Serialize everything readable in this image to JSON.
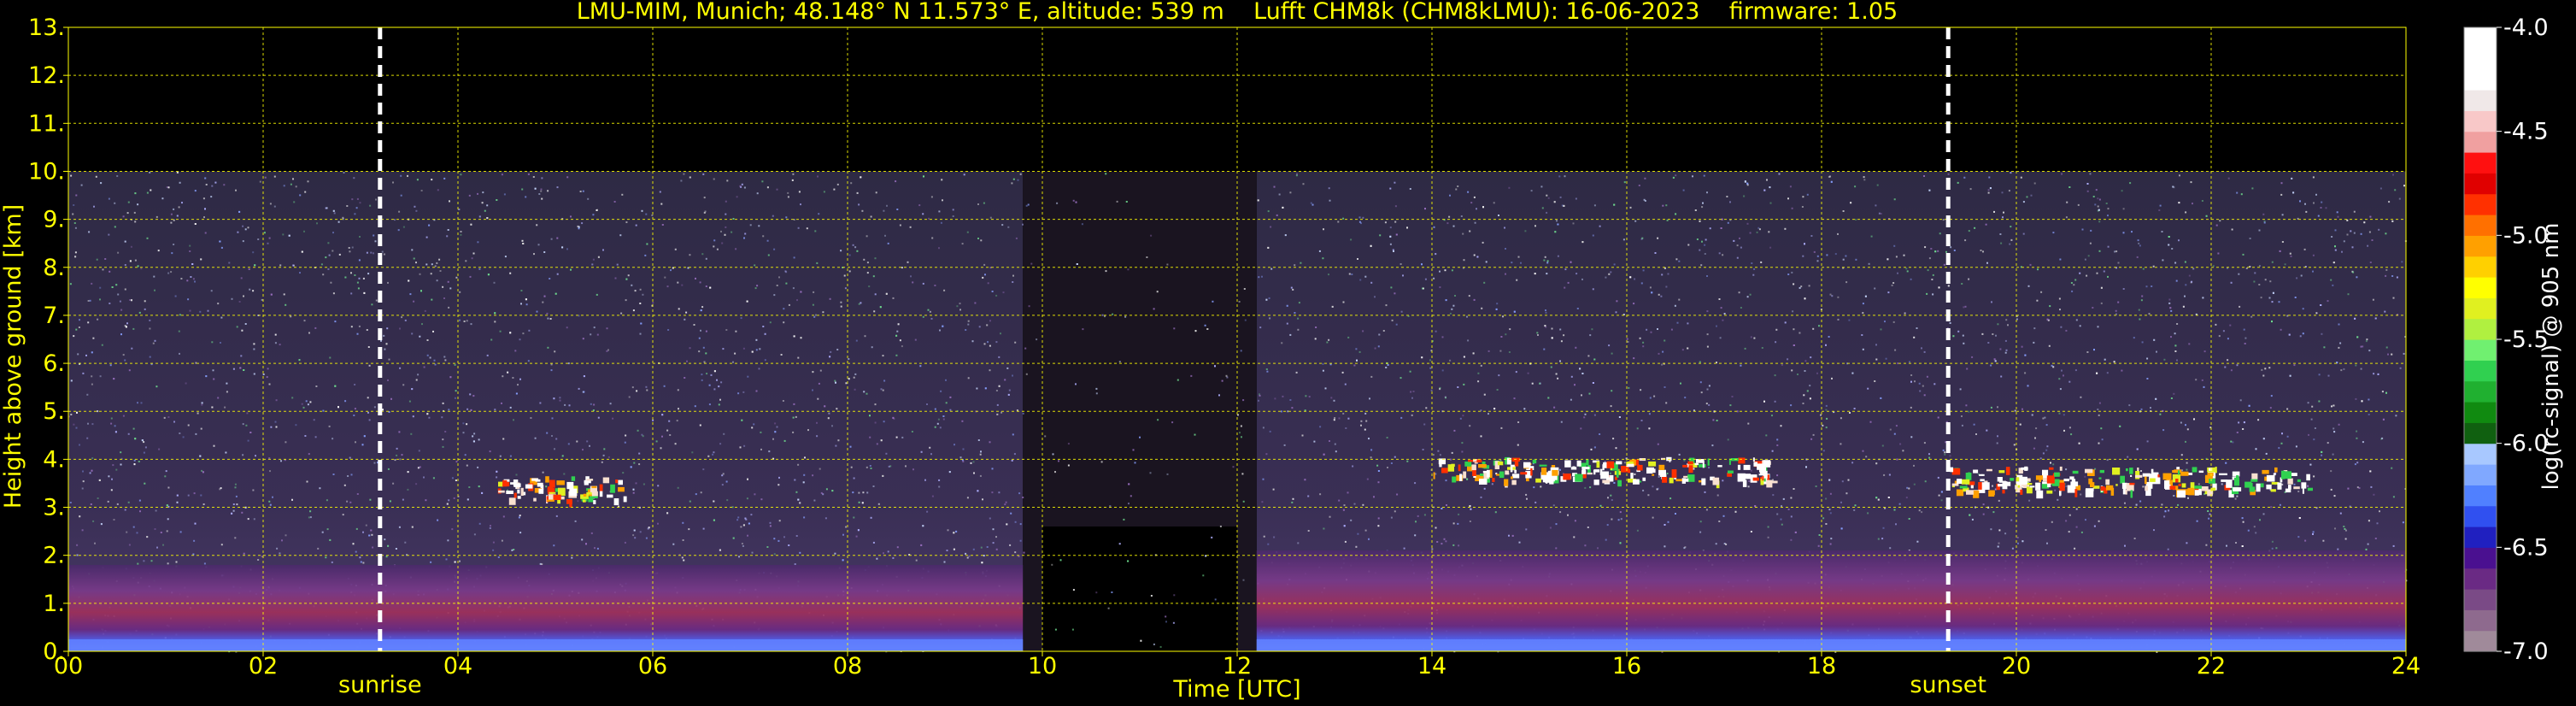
{
  "chart_data": {
    "type": "heatmap",
    "title": "LMU-MIM, Munich; 48.148° N 11.573° E, altitude: 539 m    Lufft CHM8k (CHM8kLMU): 16-06-2023    firmware: 1.05",
    "xlabel": "Time [UTC]",
    "ylabel": "Height above ground [km]",
    "xlim": [
      0,
      24
    ],
    "ylim": [
      0,
      13
    ],
    "x_ticks": [
      "00",
      "02",
      "04",
      "06",
      "08",
      "10",
      "12",
      "14",
      "16",
      "18",
      "20",
      "22",
      "24"
    ],
    "y_ticks": [
      "0.",
      "1.",
      "2.",
      "3.",
      "4.",
      "5.",
      "6.",
      "7.",
      "8.",
      "9.",
      "10.",
      "11.",
      "12.",
      "13."
    ],
    "grid": true,
    "colorbar": {
      "label": "log(rc-signal) @ 905 nm",
      "range": [
        -7.0,
        -4.0
      ],
      "ticks": [
        "-4.0",
        "-4.5",
        "-5.0",
        "-5.5",
        "-6.0",
        "-6.5",
        "-7.0"
      ],
      "colors": [
        "#a08a9a",
        "#8e6a8e",
        "#7a4a86",
        "#6a2a84",
        "#4a1090",
        "#2020c0",
        "#3050f0",
        "#5080ff",
        "#80a8ff",
        "#a8c8ff",
        "#106010",
        "#108a10",
        "#20b030",
        "#30d050",
        "#70f070",
        "#b0f040",
        "#e0f020",
        "#ffff00",
        "#ffd000",
        "#ffa000",
        "#ff7000",
        "#ff3000",
        "#e00000",
        "#ff1010",
        "#f0a0a0",
        "#f8c8c8",
        "#f0e8e8",
        "#ffffff",
        "#ffffff",
        "#ffffff"
      ]
    },
    "events": [
      {
        "label": "sunrise",
        "time": 3.2
      },
      {
        "label": "sunset",
        "time": 19.3
      }
    ],
    "measurement_range_km": 10.0,
    "data_gaps": [
      [
        9.8,
        12.2
      ]
    ],
    "features": [
      {
        "kind": "boundary_layer",
        "start": 0.0,
        "end": 9.8,
        "top_km": 1.8
      },
      {
        "kind": "boundary_layer",
        "start": 12.2,
        "end": 24.0,
        "top_km": 2.1
      },
      {
        "kind": "cloud_layer",
        "start": 4.4,
        "end": 5.7,
        "height_km": 3.4
      },
      {
        "kind": "cloud_layer",
        "start": 14.0,
        "end": 17.5,
        "height_km": 3.8
      },
      {
        "kind": "cloud_layer",
        "start": 19.3,
        "end": 23.0,
        "height_km": 3.6
      }
    ]
  }
}
